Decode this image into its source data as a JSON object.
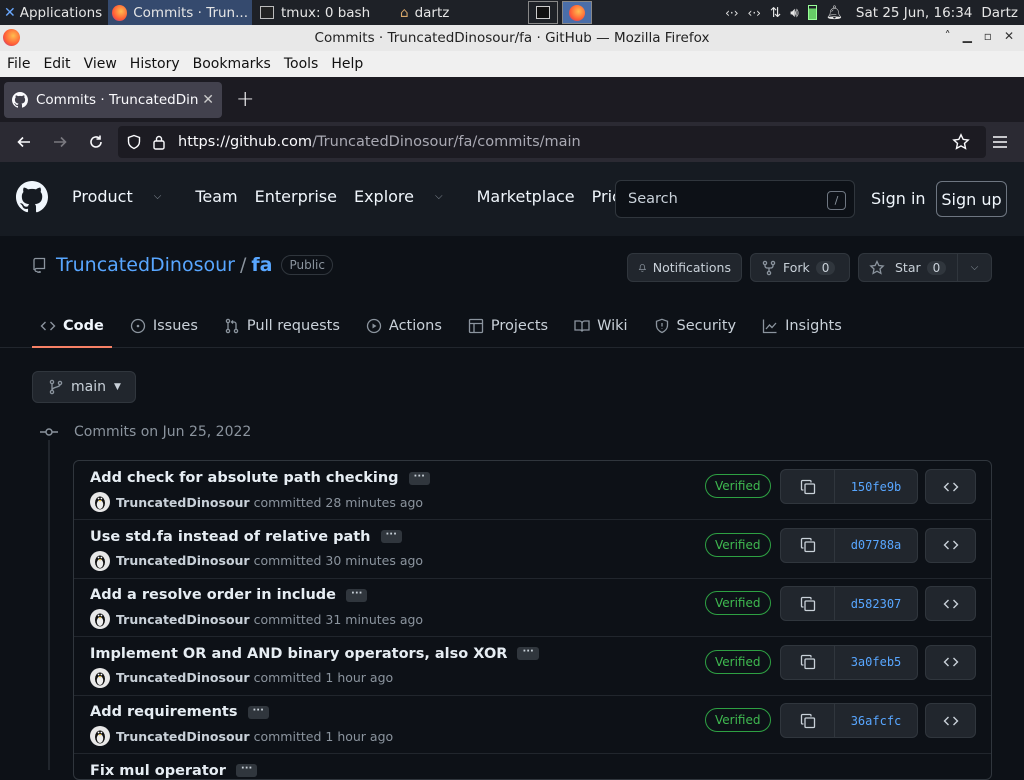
{
  "taskbar": {
    "apps_label": "Applications",
    "windows": [
      {
        "label": "Commits · Trun..."
      },
      {
        "label": "tmux: 0 bash"
      },
      {
        "label": "dartz"
      }
    ],
    "clock": "Sat 25 Jun, 16:34",
    "user": "Dartz"
  },
  "window": {
    "title": "Commits · TruncatedDinosour/fa · GitHub — Mozilla Firefox"
  },
  "menu": [
    "File",
    "Edit",
    "View",
    "History",
    "Bookmarks",
    "Tools",
    "Help"
  ],
  "tab": {
    "title": "Commits · TruncatedDinosour/fa"
  },
  "url": {
    "host": "https://github.com",
    "path": "/TruncatedDinosour/fa/commits/main"
  },
  "gh": {
    "nav": [
      "Product",
      "Team",
      "Enterprise",
      "Explore",
      "Marketplace",
      "Pricing"
    ],
    "search_placeholder": "Search",
    "search_key": "/",
    "signin": "Sign in",
    "signup": "Sign up"
  },
  "repo": {
    "owner": "TruncatedDinosour",
    "name": "fa",
    "visibility": "Public",
    "notifications": "Notifications",
    "fork": "Fork",
    "fork_count": "0",
    "star": "Star",
    "star_count": "0",
    "tabs": [
      "Code",
      "Issues",
      "Pull requests",
      "Actions",
      "Projects",
      "Wiki",
      "Security",
      "Insights"
    ]
  },
  "branch": "main",
  "commits_date": "Commits on Jun 25, 2022",
  "commits": [
    {
      "message": "Add check for absolute path checking",
      "author": "TruncatedDinosour",
      "action": "committed",
      "time": "28 minutes ago",
      "badge": "Verified",
      "sha": "150fe9b"
    },
    {
      "message": "Use std.fa instead of relative path",
      "author": "TruncatedDinosour",
      "action": "committed",
      "time": "30 minutes ago",
      "badge": "Verified",
      "sha": "d07788a"
    },
    {
      "message": "Add a resolve order in include",
      "author": "TruncatedDinosour",
      "action": "committed",
      "time": "31 minutes ago",
      "badge": "Verified",
      "sha": "d582307"
    },
    {
      "message": "Implement OR and AND binary operators, also XOR",
      "author": "TruncatedDinosour",
      "action": "committed",
      "time": "1 hour ago",
      "badge": "Verified",
      "sha": "3a0feb5"
    },
    {
      "message": "Add requirements",
      "author": "TruncatedDinosour",
      "action": "committed",
      "time": "1 hour ago",
      "badge": "Verified",
      "sha": "36afcfc"
    },
    {
      "message": "Fix mul operator",
      "author": "",
      "action": "",
      "time": "",
      "badge": "",
      "sha": ""
    }
  ],
  "colors": {
    "accent": "#58a6ff",
    "verified": "#3fb950",
    "active_tab": "#f78166"
  }
}
